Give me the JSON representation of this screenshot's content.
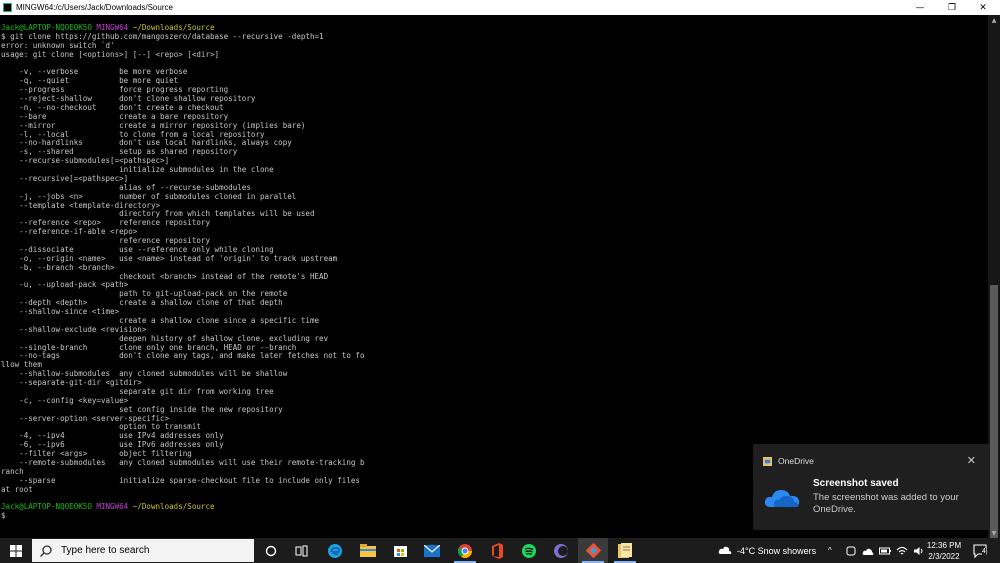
{
  "window": {
    "title": "MINGW64:/c/Users/Jack/Downloads/Source",
    "minimize": "—",
    "maximize": "❐",
    "close": "✕"
  },
  "terminal": {
    "prompt1_user": "Jack@LAPTOP-NQOEOK5O",
    "prompt1_env": "MINGW64",
    "prompt1_path": "~/Downloads/Source",
    "command": "$ git clone https://github.com/mangoszero/database --recursive -depth=1",
    "output": "error: unknown switch `d'\nusage: git clone [<options>] [--] <repo> [<dir>]\n\n    -v, --verbose         be more verbose\n    -q, --quiet           be more quiet\n    --progress            force progress reporting\n    --reject-shallow      don't clone shallow repository\n    -n, --no-checkout     don't create a checkout\n    --bare                create a bare repository\n    --mirror              create a mirror repository (implies bare)\n    -l, --local           to clone from a local repository\n    --no-hardlinks        don't use local hardlinks, always copy\n    -s, --shared          setup as shared repository\n    --recurse-submodules[=<pathspec>]\n                          initialize submodules in the clone\n    --recursive[=<pathspec>]\n                          alias of --recurse-submodules\n    -j, --jobs <n>        number of submodules cloned in parallel\n    --template <template-directory>\n                          directory from which templates will be used\n    --reference <repo>    reference repository\n    --reference-if-able <repo>\n                          reference repository\n    --dissociate          use --reference only while cloning\n    -o, --origin <name>   use <name> instead of 'origin' to track upstream\n    -b, --branch <branch>\n                          checkout <branch> instead of the remote's HEAD\n    -u, --upload-pack <path>\n                          path to git-upload-pack on the remote\n    --depth <depth>       create a shallow clone of that depth\n    --shallow-since <time>\n                          create a shallow clone since a specific time\n    --shallow-exclude <revision>\n                          deepen history of shallow clone, excluding rev\n    --single-branch       clone only one branch, HEAD or --branch\n    --no-tags             don't clone any tags, and make later fetches not to fo\nllow them\n    --shallow-submodules  any cloned submodules will be shallow\n    --separate-git-dir <gitdir>\n                          separate git dir from working tree\n    -c, --config <key=value>\n                          set config inside the new repository\n    --server-option <server-specific>\n                          option to transmit\n    -4, --ipv4            use IPv4 addresses only\n    -6, --ipv6            use IPv6 addresses only\n    --filter <args>       object filtering\n    --remote-submodules   any cloned submodules will use their remote-tracking b\nranch\n    --sparse              initialize sparse-checkout file to include only files\nat root\n",
    "prompt2_user": "Jack@LAPTOP-NQOEOK5O",
    "prompt2_env": "MINGW64",
    "prompt2_path": "~/Downloads/Source",
    "prompt2_symbol": "$"
  },
  "toast": {
    "app_name": "OneDrive",
    "close": "✕",
    "heading": "Screenshot saved",
    "body": "The screenshot was added to your OneDrive."
  },
  "taskbar": {
    "search_placeholder": "Type here to search",
    "weather": "-4°C  Snow showers",
    "time": "12:36 PM",
    "date": "2/3/2022",
    "notification_count": "4",
    "icons": [
      "cortana-icon",
      "task-view-icon",
      "edge-icon",
      "file-explorer-icon",
      "microsoft-store-icon",
      "mail-icon",
      "chrome-icon",
      "office-icon",
      "spotify-icon",
      "eclipse-icon",
      "git-bash-icon",
      "notes-icon"
    ]
  },
  "colors": {
    "prompt_user": "#13c20b",
    "prompt_env": "#c43ed4",
    "prompt_path": "#c9c328",
    "toast_bg": "#1f1f1f",
    "taskbar_bg": "#1c1c1c"
  }
}
